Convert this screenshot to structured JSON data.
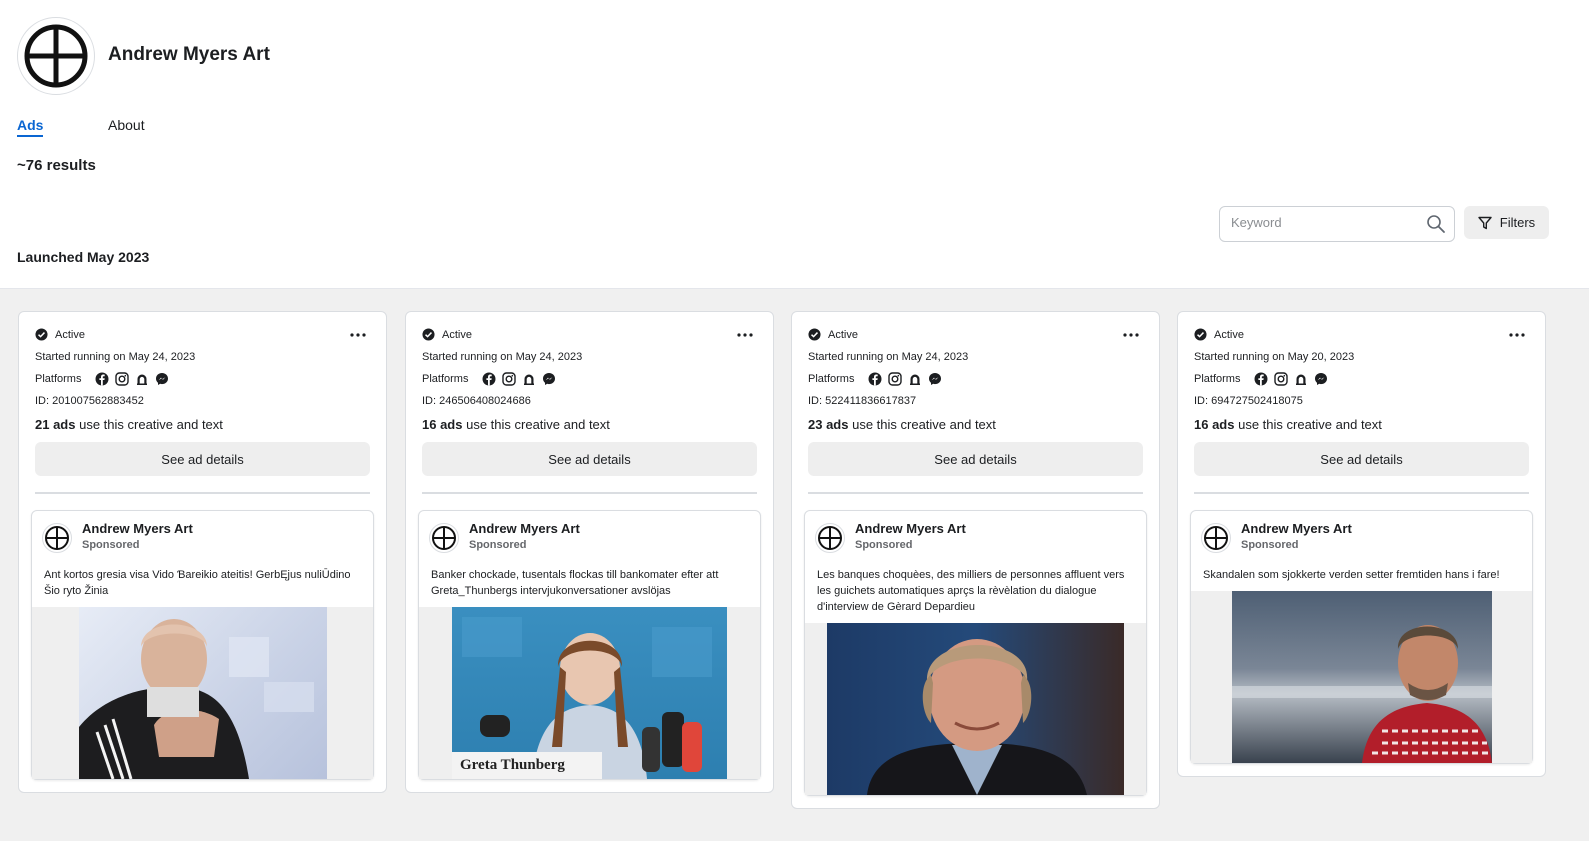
{
  "page": {
    "name": "Andrew Myers Art",
    "tabs": [
      {
        "label": "Ads"
      },
      {
        "label": "About"
      }
    ],
    "results": "~76 results",
    "search_placeholder": "Keyword",
    "filters_label": "Filters",
    "section_title": "Launched May 2023"
  },
  "colors": {
    "accent": "#0a66d2",
    "grid_background": "#f0f0f0",
    "button_gray": "#eeeeee"
  },
  "cards": [
    {
      "status": "Active",
      "started": "Started running on May 24, 2023",
      "platforms_label": "Platforms",
      "platform_icons": [
        "facebook-icon",
        "instagram-icon",
        "audience-network-icon",
        "messenger-icon"
      ],
      "id": "ID: 201007562883452",
      "ads_count": "21 ads",
      "ads_suffix": " use this creative and text",
      "details_label": "See ad details",
      "advertiser": "Andrew Myers Art",
      "sponsored": "Sponsored",
      "ad_text": "Ant kortos gresia visa Vido Ɓareikio ateitis! GerbĘjus nuliŪdino Šio ryto Žinia"
    },
    {
      "status": "Active",
      "started": "Started running on May 24, 2023",
      "platforms_label": "Platforms",
      "platform_icons": [
        "facebook-icon",
        "instagram-icon",
        "audience-network-icon",
        "messenger-icon"
      ],
      "id": "ID: 246506408024686",
      "ads_count": "16 ads",
      "ads_suffix": " use this creative and text",
      "details_label": "See ad details",
      "advertiser": "Andrew Myers Art",
      "sponsored": "Sponsored",
      "ad_text": "Banker chockade, tusentals flockas till bankomater efter att Greta_Thunbergs intervjukonversationer avslöjas",
      "photo_caption": "Greta Thunberg"
    },
    {
      "status": "Active",
      "started": "Started running on May 24, 2023",
      "platforms_label": "Platforms",
      "platform_icons": [
        "facebook-icon",
        "instagram-icon",
        "audience-network-icon",
        "messenger-icon"
      ],
      "id": "ID: 522411836617837",
      "ads_count": "23 ads",
      "ads_suffix": " use this creative and text",
      "details_label": "See ad details",
      "advertiser": "Andrew Myers Art",
      "sponsored": "Sponsored",
      "ad_text": "Les banques choquèes, des milliers de personnes affluent vers les guichets automatiques aprçs la rèvèlation du dialogue d'interview de Gèrard Depardieu"
    },
    {
      "status": "Active",
      "started": "Started running on May 20, 2023",
      "platforms_label": "Platforms",
      "platform_icons": [
        "facebook-icon",
        "instagram-icon",
        "audience-network-icon",
        "messenger-icon"
      ],
      "id": "ID: 694727502418075",
      "ads_count": "16 ads",
      "ads_suffix": " use this creative and text",
      "details_label": "See ad details",
      "advertiser": "Andrew Myers Art",
      "sponsored": "Sponsored",
      "ad_text": "Skandalen som sjokkerte verden setter fremtiden hans i fare!"
    }
  ]
}
